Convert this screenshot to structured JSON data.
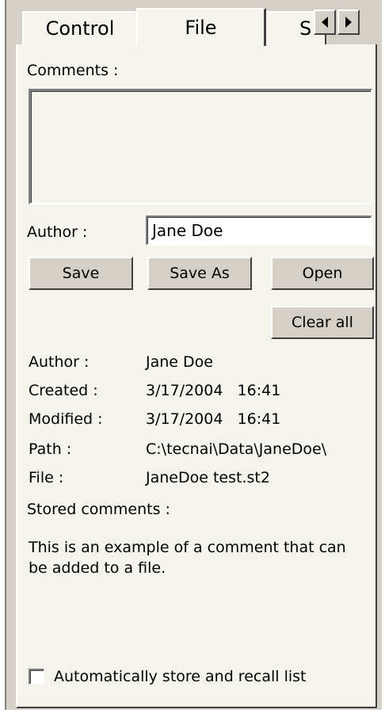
{
  "tabs": [
    {
      "label": "Control",
      "active": false
    },
    {
      "label": "File",
      "active": true
    },
    {
      "label": "S",
      "active": false
    }
  ],
  "tab_scroll": {
    "left_icon": "arrow-left-icon",
    "right_icon": "arrow-right-icon"
  },
  "comments": {
    "label": "Comments :",
    "value": ""
  },
  "author_field": {
    "label": "Author :",
    "value": "Jane Doe"
  },
  "buttons": {
    "save": "Save",
    "save_as": "Save As",
    "open": "Open",
    "clear_all": "Clear all"
  },
  "info": {
    "author": {
      "key": "Author :",
      "value": "Jane Doe"
    },
    "created": {
      "key": "Created :",
      "value": "3/17/2004   16:41"
    },
    "modified": {
      "key": "Modified :",
      "value": "3/17/2004   16:41"
    },
    "path": {
      "key": "Path :",
      "value": "C:\\tecnai\\Data\\JaneDoe\\"
    },
    "file": {
      "key": "File :",
      "value": "JaneDoe test.st2"
    }
  },
  "stored_comments": {
    "label": "Stored comments :",
    "text": "This is an example of a comment that can be added to a file."
  },
  "auto_store": {
    "label": "Automatically store and recall list",
    "checked": false
  }
}
